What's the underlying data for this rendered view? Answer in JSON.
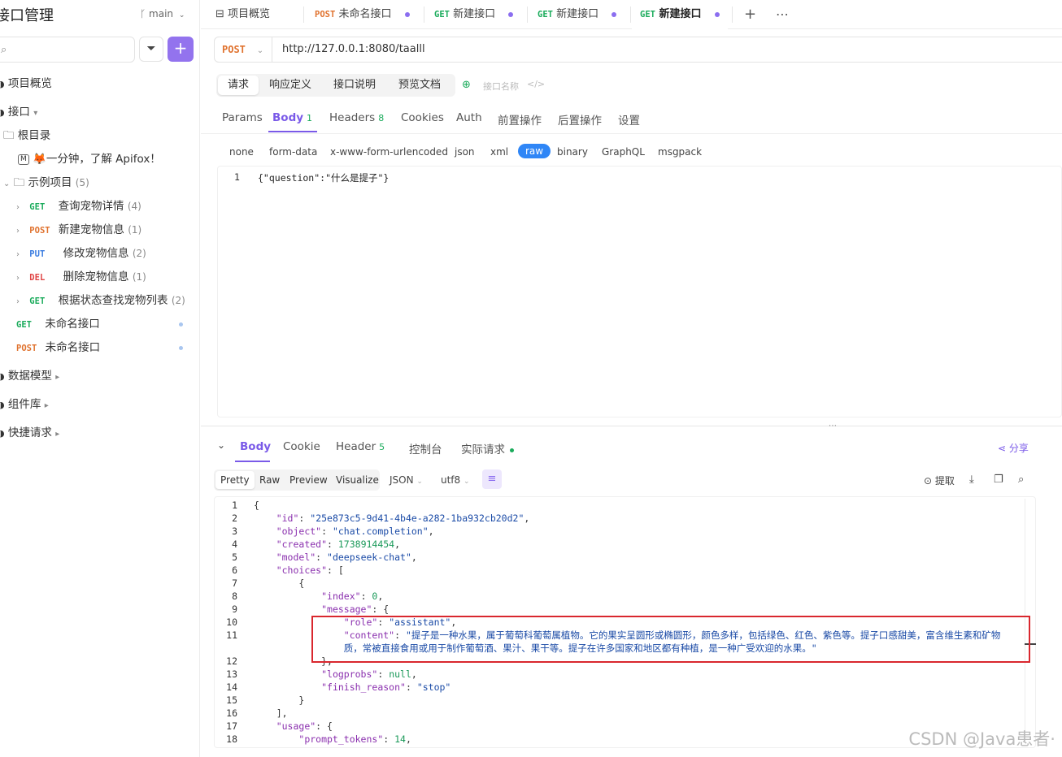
{
  "sidebar": {
    "title": "接口管理",
    "branch": "main",
    "search_placeholder": "",
    "items": [
      {
        "label": "项目概览"
      },
      {
        "label": "接口"
      },
      {
        "label": "根目录"
      },
      {
        "label": "🦊一分钟，了解 Apifox！"
      },
      {
        "label": "示例项目",
        "count": "(5)"
      },
      {
        "method": "GET",
        "label": "查询宠物详情",
        "count": "(4)"
      },
      {
        "method": "POST",
        "label": "新建宠物信息",
        "count": "(1)"
      },
      {
        "method": "PUT",
        "label": "修改宠物信息",
        "count": "(2)"
      },
      {
        "method": "DEL",
        "label": "删除宠物信息",
        "count": "(1)"
      },
      {
        "method": "GET",
        "label": "根据状态查找宠物列表",
        "count": "(2)"
      },
      {
        "method": "GET",
        "label": "未命名接口"
      },
      {
        "method": "POST",
        "label": "未命名接口"
      },
      {
        "label": "数据模型"
      },
      {
        "label": "组件库"
      },
      {
        "label": "快捷请求"
      }
    ]
  },
  "tabs": [
    {
      "label": "项目概览"
    },
    {
      "method": "POST",
      "label": "未命名接口"
    },
    {
      "method": "GET",
      "label": "新建接口"
    },
    {
      "method": "GET",
      "label": "新建接口"
    },
    {
      "method": "GET",
      "label": "新建接口"
    }
  ],
  "request": {
    "method": "POST",
    "url": "http://127.0.0.1:8080/taalll",
    "segments": [
      "请求",
      "响应定义",
      "接口说明",
      "预览文档"
    ],
    "name_placeholder": "接口名称",
    "param_tabs": [
      {
        "label": "Params"
      },
      {
        "label": "Body",
        "badge": "1"
      },
      {
        "label": "Headers",
        "badge": "8"
      },
      {
        "label": "Cookies"
      },
      {
        "label": "Auth"
      },
      {
        "label": "前置操作"
      },
      {
        "label": "后置操作"
      },
      {
        "label": "设置"
      }
    ],
    "body_types": [
      "none",
      "form-data",
      "x-www-form-urlencoded",
      "json",
      "xml",
      "raw",
      "binary",
      "GraphQL",
      "msgpack"
    ],
    "body_line_no": "1",
    "body": "{\"question\":\"什么是提子\"}"
  },
  "response": {
    "tabs": [
      {
        "label": "Body"
      },
      {
        "label": "Cookie"
      },
      {
        "label": "Header",
        "badge": "5"
      },
      {
        "label": "控制台"
      },
      {
        "label": "实际请求"
      }
    ],
    "share": "分享",
    "views": [
      "Pretty",
      "Raw",
      "Preview",
      "Visualize"
    ],
    "format": "JSON",
    "encoding": "utf8",
    "extract": "提取",
    "lines": [
      {
        "n": "1",
        "t": "{"
      },
      {
        "n": "2",
        "t": "    \"id\": \"25e873c5-9d41-4b4e-a282-1ba932cb20d2\","
      },
      {
        "n": "3",
        "t": "    \"object\": \"chat.completion\","
      },
      {
        "n": "4",
        "t": "    \"created\": 1738914454,"
      },
      {
        "n": "5",
        "t": "    \"model\": \"deepseek-chat\","
      },
      {
        "n": "6",
        "t": "    \"choices\": ["
      },
      {
        "n": "7",
        "t": "        {"
      },
      {
        "n": "8",
        "t": "            \"index\": 0,"
      },
      {
        "n": "9",
        "t": "            \"message\": {"
      },
      {
        "n": "10",
        "t": "                \"role\": \"assistant\","
      },
      {
        "n": "11",
        "t": "                \"content\": \"提子是一种水果，属于葡萄科葡萄属植物。它的果实呈圆形或椭圆形，颜色多样，包括绿色、红色、紫色等。提子口感甜美，富含维生素和矿物"
      },
      {
        "n": "",
        "t": "                质，常被直接食用或用于制作葡萄酒、果汁、果干等。提子在许多国家和地区都有种植，是一种广受欢迎的水果。\""
      },
      {
        "n": "12",
        "t": "            },"
      },
      {
        "n": "13",
        "t": "            \"logprobs\": null,"
      },
      {
        "n": "14",
        "t": "            \"finish_reason\": \"stop\""
      },
      {
        "n": "15",
        "t": "        }"
      },
      {
        "n": "16",
        "t": "    ],"
      },
      {
        "n": "17",
        "t": "    \"usage\": {"
      },
      {
        "n": "18",
        "t": "        \"prompt_tokens\": 14,"
      }
    ]
  },
  "watermark": "CSDN @Java患者·"
}
